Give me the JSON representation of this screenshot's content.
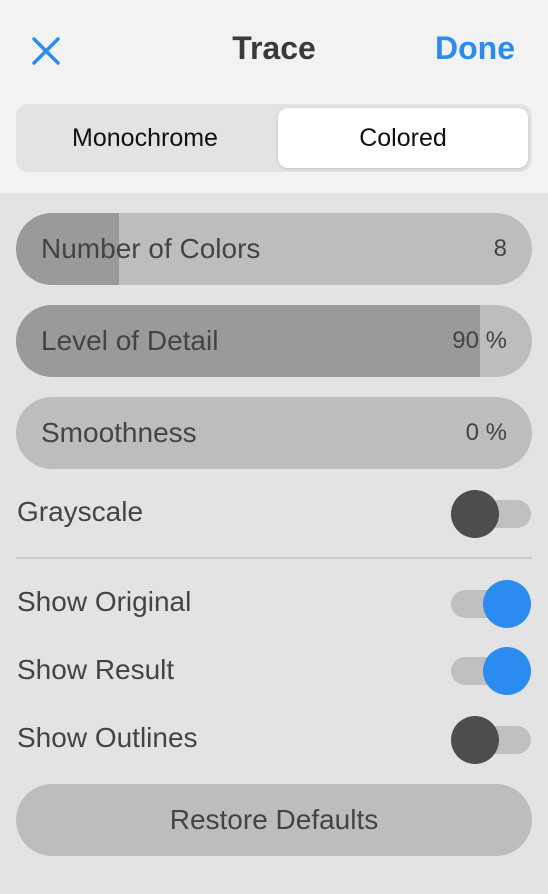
{
  "header": {
    "close_icon": "close-icon",
    "title": "Trace",
    "done_label": "Done",
    "accent_color": "#2a8cf0"
  },
  "mode_tabs": {
    "items": [
      "Monochrome",
      "Colored"
    ],
    "selected": "Colored"
  },
  "sliders": [
    {
      "label": "Number of Colors",
      "value": "8",
      "fill_fraction": 0.2
    },
    {
      "label": "Level of Detail",
      "value": "90 %",
      "fill_fraction": 0.9
    },
    {
      "label": "Smoothness",
      "value": "0 %",
      "fill_fraction": 0.0
    }
  ],
  "toggles": [
    {
      "label": "Grayscale",
      "on": false
    },
    {
      "label": "Show Original",
      "on": true
    },
    {
      "label": "Show Result",
      "on": true
    },
    {
      "label": "Show Outlines",
      "on": false
    }
  ],
  "restore_label": "Restore Defaults"
}
